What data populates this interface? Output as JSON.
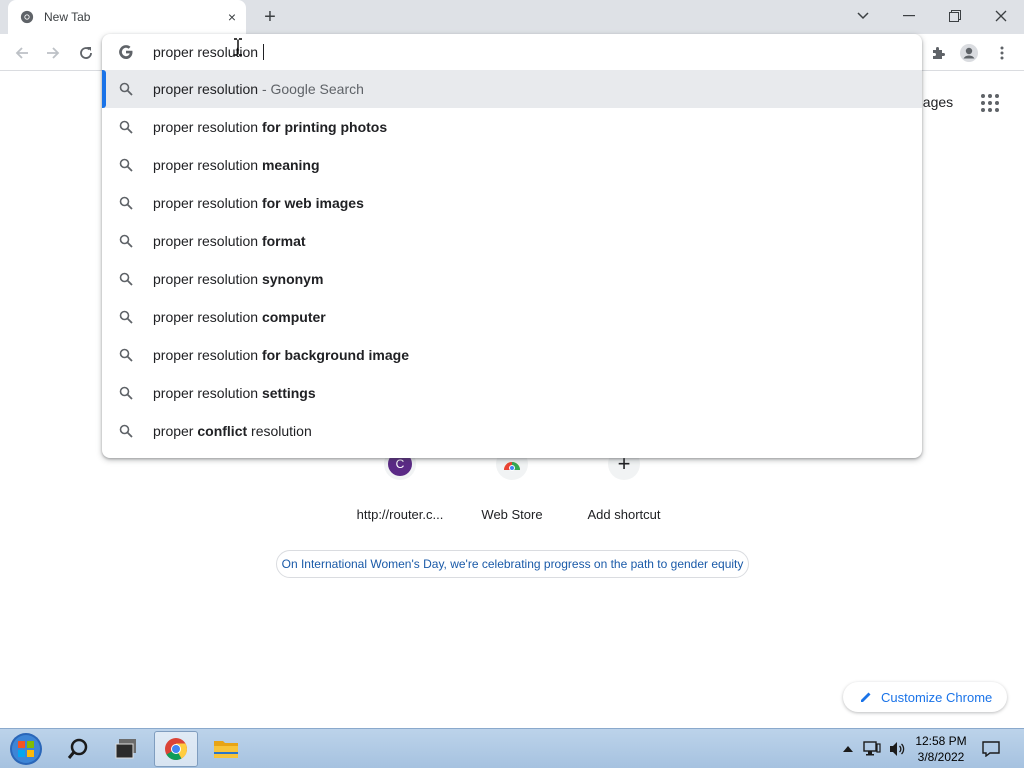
{
  "browser": {
    "tab_title": "New Tab",
    "tab_close": "×",
    "new_tab": "+",
    "omnibox_value": "proper resolution "
  },
  "suggestions": [
    {
      "query": "proper resolution",
      "bold": "",
      "tail": "",
      "desc": " - Google Search",
      "selected": true
    },
    {
      "query": "proper resolution ",
      "bold": "for printing photos",
      "tail": "",
      "desc": ""
    },
    {
      "query": "proper resolution ",
      "bold": "meaning",
      "tail": "",
      "desc": ""
    },
    {
      "query": "proper resolution ",
      "bold": "for web images",
      "tail": "",
      "desc": ""
    },
    {
      "query": "proper resolution ",
      "bold": "format",
      "tail": "",
      "desc": ""
    },
    {
      "query": "proper resolution ",
      "bold": "synonym",
      "tail": "",
      "desc": ""
    },
    {
      "query": "proper resolution ",
      "bold": "computer",
      "tail": "",
      "desc": ""
    },
    {
      "query": "proper resolution ",
      "bold": "for background image",
      "tail": "",
      "desc": ""
    },
    {
      "query": "proper resolution ",
      "bold": "settings",
      "tail": "",
      "desc": ""
    },
    {
      "query": "proper ",
      "bold": "conflict",
      "tail": " resolution",
      "desc": ""
    }
  ],
  "ntp": {
    "images_link": "nages",
    "shortcuts": [
      {
        "label": "http://router.c...",
        "letter": "C"
      },
      {
        "label": "Web Store",
        "letter": ""
      },
      {
        "label": "Add shortcut",
        "letter": "+"
      }
    ],
    "doodle_message": "On International Women's Day, we're celebrating progress on the path to gender equity",
    "customize_label": "Customize Chrome"
  },
  "taskbar": {
    "time": "12:58 PM",
    "date": "3/8/2022"
  },
  "colors": {
    "accent": "#1a73e8",
    "shortcut_c": "#5b2a86"
  }
}
